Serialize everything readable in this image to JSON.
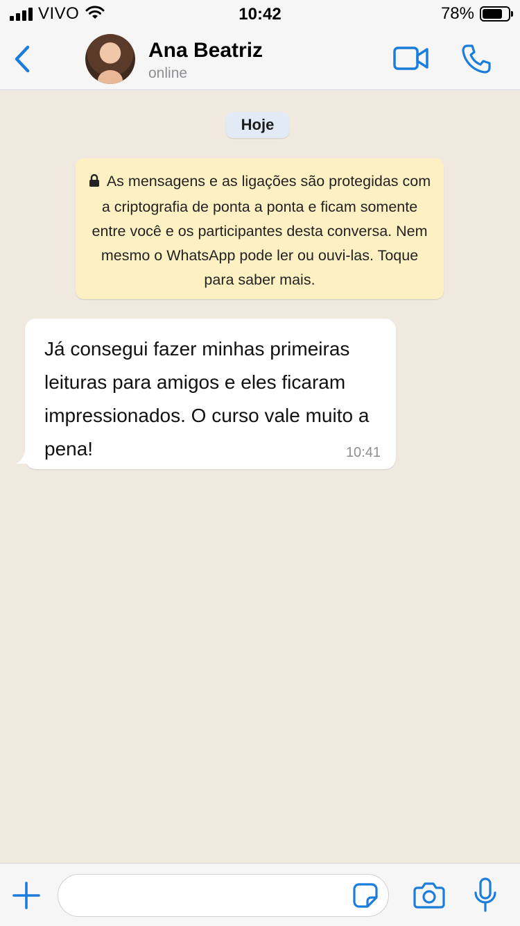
{
  "status_bar": {
    "carrier": "VIVO",
    "time": "10:42",
    "battery_percent": "78%",
    "battery_level": 0.78,
    "icons": [
      "signal-icon",
      "wifi-icon",
      "battery-icon"
    ]
  },
  "header": {
    "contact_name": "Ana Beatriz",
    "contact_status": "online",
    "icons": [
      "chevron-left-icon",
      "video-camera-icon",
      "phone-icon"
    ]
  },
  "chat": {
    "date_label": "Hoje",
    "encryption_notice": "As mensagens e as ligações são protegidas com a criptografia de ponta a ponta e ficam somente entre você e os participantes desta conversa. Nem mesmo o WhatsApp pode ler ou ouvi-las. Toque para saber mais.",
    "messages": [
      {
        "direction": "incoming",
        "text": "Já consegui fazer minhas primeiras leituras para amigos e eles ficaram impressionados. O curso vale muito a pena!",
        "time": "10:41"
      }
    ]
  },
  "input_bar": {
    "message_value": "",
    "icons": [
      "plus-icon",
      "sticker-icon",
      "camera-icon",
      "microphone-icon"
    ]
  },
  "colors": {
    "accent": "#1a7ddb",
    "chat_background": "#efe9e0",
    "notice_background": "#fdf1c4",
    "date_pill_background": "#e2eaf6",
    "bubble_background": "#ffffff"
  }
}
